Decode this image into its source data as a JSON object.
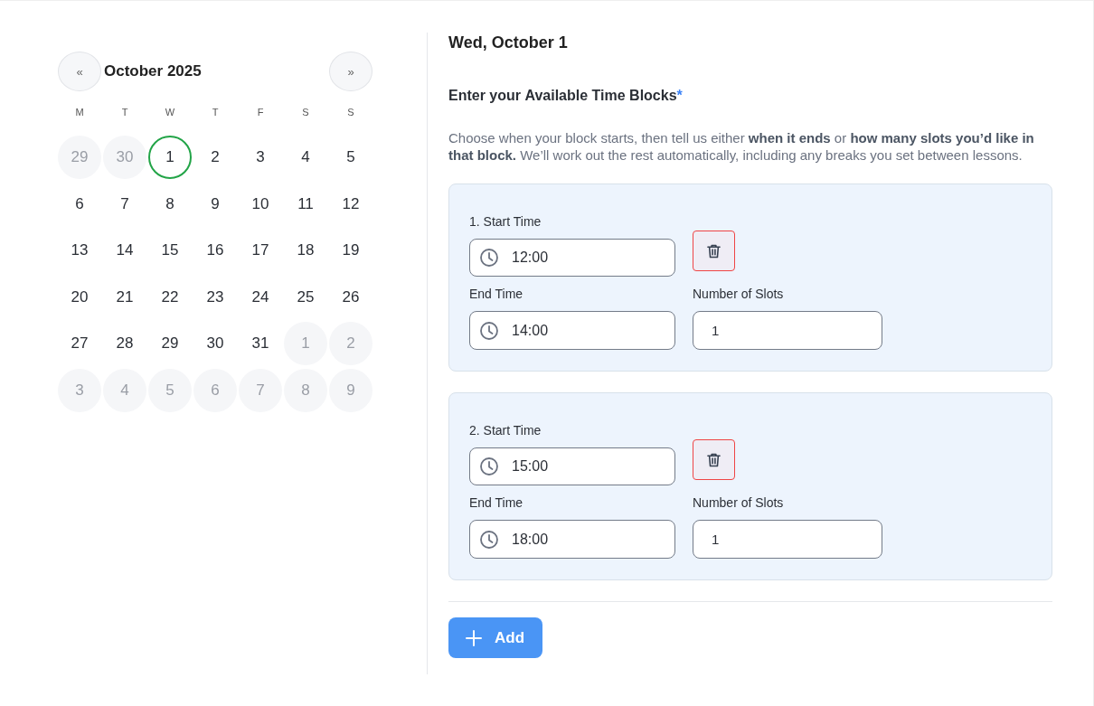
{
  "calendar": {
    "prev_button": "«",
    "month_title": "October 2025",
    "next_button": "»",
    "weekdays": [
      "M",
      "T",
      "W",
      "T",
      "F",
      "S",
      "S"
    ],
    "days": [
      {
        "label": "29",
        "outside": true,
        "selected": false
      },
      {
        "label": "30",
        "outside": true,
        "selected": false
      },
      {
        "label": "1",
        "outside": false,
        "selected": true
      },
      {
        "label": "2",
        "outside": false,
        "selected": false
      },
      {
        "label": "3",
        "outside": false,
        "selected": false
      },
      {
        "label": "4",
        "outside": false,
        "selected": false
      },
      {
        "label": "5",
        "outside": false,
        "selected": false
      },
      {
        "label": "6",
        "outside": false,
        "selected": false
      },
      {
        "label": "7",
        "outside": false,
        "selected": false
      },
      {
        "label": "8",
        "outside": false,
        "selected": false
      },
      {
        "label": "9",
        "outside": false,
        "selected": false
      },
      {
        "label": "10",
        "outside": false,
        "selected": false
      },
      {
        "label": "11",
        "outside": false,
        "selected": false
      },
      {
        "label": "12",
        "outside": false,
        "selected": false
      },
      {
        "label": "13",
        "outside": false,
        "selected": false
      },
      {
        "label": "14",
        "outside": false,
        "selected": false
      },
      {
        "label": "15",
        "outside": false,
        "selected": false
      },
      {
        "label": "16",
        "outside": false,
        "selected": false
      },
      {
        "label": "17",
        "outside": false,
        "selected": false
      },
      {
        "label": "18",
        "outside": false,
        "selected": false
      },
      {
        "label": "19",
        "outside": false,
        "selected": false
      },
      {
        "label": "20",
        "outside": false,
        "selected": false
      },
      {
        "label": "21",
        "outside": false,
        "selected": false
      },
      {
        "label": "22",
        "outside": false,
        "selected": false
      },
      {
        "label": "23",
        "outside": false,
        "selected": false
      },
      {
        "label": "24",
        "outside": false,
        "selected": false
      },
      {
        "label": "25",
        "outside": false,
        "selected": false
      },
      {
        "label": "26",
        "outside": false,
        "selected": false
      },
      {
        "label": "27",
        "outside": false,
        "selected": false
      },
      {
        "label": "28",
        "outside": false,
        "selected": false
      },
      {
        "label": "29",
        "outside": false,
        "selected": false
      },
      {
        "label": "30",
        "outside": false,
        "selected": false
      },
      {
        "label": "31",
        "outside": false,
        "selected": false
      },
      {
        "label": "1",
        "outside": true,
        "selected": false
      },
      {
        "label": "2",
        "outside": true,
        "selected": false
      },
      {
        "label": "3",
        "outside": true,
        "selected": false
      },
      {
        "label": "4",
        "outside": true,
        "selected": false
      },
      {
        "label": "5",
        "outside": true,
        "selected": false
      },
      {
        "label": "6",
        "outside": true,
        "selected": false
      },
      {
        "label": "7",
        "outside": true,
        "selected": false
      },
      {
        "label": "8",
        "outside": true,
        "selected": false
      },
      {
        "label": "9",
        "outside": true,
        "selected": false
      }
    ]
  },
  "detail": {
    "date_title": "Wed, October 1",
    "heading": "Enter your **Available Time Blocks**",
    "required_mark": "*",
    "description": "Choose when your block starts, then tell us either **when it ends** or **how many slots you’d like in that block.** We’ll work out the rest automatically, including any breaks you set between lessons.",
    "time_blocks": [
      {
        "start_label": "1. Start Time",
        "start": "12:00",
        "end_label": "End Time",
        "end": "14:00",
        "slots_label": "Number of Slots",
        "slots": "1"
      },
      {
        "start_label": "2. Start Time",
        "start": "15:00",
        "end_label": "End Time",
        "end": "18:00",
        "slots_label": "Number of Slots",
        "slots": "1"
      }
    ],
    "add_button": "Add"
  }
}
